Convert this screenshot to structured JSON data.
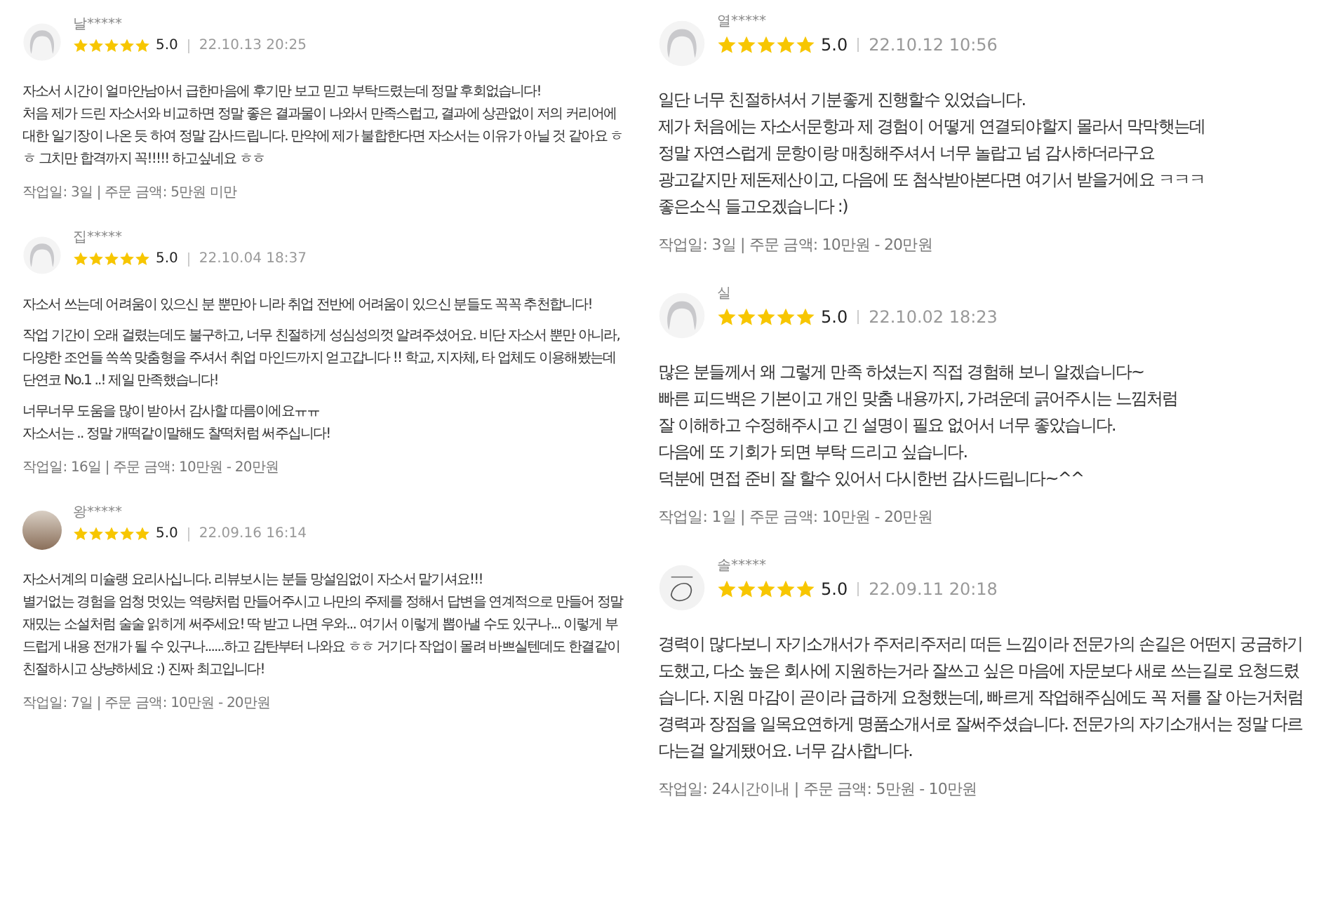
{
  "columns": [
    {
      "kind": "compact",
      "reviews": [
        {
          "avatar": {
            "kind": "default"
          },
          "name": "날*****",
          "stars": 5,
          "rating": "5.0",
          "date": "22.10.13 20:25",
          "paragraphs": [
            "자소서 시간이 얼마안남아서 급한마음에 후기만 보고 믿고 부탁드렸는데 정말 후회없습니다!\n처음 제가 드린 자소서와 비교하면 정말 좋은 결과물이 나와서 만족스럽고, 결과에 상관없이 저의 커리어에 대한 일기장이 나온 듯 하여 정말 감사드립니다. 만약에 제가 불합한다면 자소서는 이유가 아닐 것 같아요 ㅎㅎ 그치만 합격까지 꼭!!!!! 하고싶네요 ㅎㅎ"
          ],
          "meta": "작업일: 3일 | 주문 금액: 5만원 미만"
        },
        {
          "avatar": {
            "kind": "default"
          },
          "name": "집*****",
          "stars": 5,
          "rating": "5.0",
          "date": "22.10.04 18:37",
          "paragraphs": [
            "자소서 쓰는데 어려움이 있으신 분 뿐만아 니라 취업 전반에 어려움이 있으신 분들도 꼭꼭 추천합니다!",
            "작업 기간이 오래 걸렸는데도 불구하고, 너무 친절하게 성심성의껏 알려주셨어요. 비단 자소서 뿐만 아니라, 다양한 조언들 쏙쏙 맞춤형을 주셔서 취업 마인드까지 얻고갑니다 !! 학교, 지자체, 타 업체도 이용해봤는데 단연코 No.1 ..! 제일 만족했습니다!",
            "너무너무 도움을 많이 받아서 감사할 따름이에요ㅠㅠ\n자소서는 .. 정말 개떡같이말해도 찰떡처럼 써주십니다!"
          ],
          "meta": "작업일: 16일 | 주문 금액: 10만원 - 20만원"
        },
        {
          "avatar": {
            "kind": "photo"
          },
          "name": "왕*****",
          "stars": 5,
          "rating": "5.0",
          "date": "22.09.16 16:14",
          "paragraphs": [
            "자소서계의 미슐랭 요리사십니다. 리뷰보시는 분들 망설임없이 자소서 맡기셔요!!!\n별거없는 경험을 엄청 멋있는 역량처럼 만들어주시고 나만의 주제를 정해서 답변을 연계적으로 만들어 정말 재밌는 소설처럼 술술 읽히게 써주세요! 딱 받고 나면 우와... 여기서 이렇게 뽑아낼 수도  있구나... 이렇게 부드럽게 내용 전개가 될 수 있구나......하고 감탄부터 나와요 ㅎㅎ  거기다 작업이 몰려 바쁘실텐데도 한결같이 친절하시고 상냥하세요 :) 진짜 최고입니다!"
          ],
          "meta": "작업일: 7일 | 주문 금액: 10만원 - 20만원"
        }
      ]
    },
    {
      "kind": "wide",
      "reviews": [
        {
          "avatar": {
            "kind": "default"
          },
          "name": "열*****",
          "stars": 5,
          "rating": "5.0",
          "date": "22.10.12 10:56",
          "paragraphs": [
            "일단 너무 친절하셔서 기분좋게 진행할수 있었습니다.\n제가 처음에는 자소서문항과 제 경험이 어떻게 연결되야할지 몰라서 막막햇는데\n정말 자연스럽게 문항이랑 매칭해주셔서 너무 놀랍고 넘 감사하더라구요\n광고같지만 제돈제산이고, 다음에 또 첨삭받아본다면 여기서 받을거에요 ㅋㅋㅋ\n좋은소식 들고오겠습니다 :)"
          ],
          "meta": "작업일: 3일 | 주문 금액: 10만원 - 20만원"
        },
        {
          "avatar": {
            "kind": "default"
          },
          "name": "실",
          "stars": 5,
          "rating": "5.0",
          "date": "22.10.02 18:23",
          "paragraphs": [
            "많은 분들께서 왜 그렇게 만족 하셨는지 직접 경험해 보니 알겠습니다~\n빠른 피드백은 기본이고 개인 맞춤 내용까지, 가려운데 긁어주시는 느낌처럼\n잘 이해하고 수정해주시고 긴 설명이 필요 없어서 너무 좋았습니다.\n다음에 또 기회가 되면 부탁 드리고 싶습니다.\n덕분에 면접 준비 잘 할수 있어서 다시한번 감사드립니다~^^"
          ],
          "meta": "작업일: 1일 | 주문 금액: 10만원 - 20만원"
        },
        {
          "avatar": {
            "kind": "drawing"
          },
          "name": "솔*****",
          "stars": 5,
          "rating": "5.0",
          "date": "22.09.11 20:18",
          "paragraphs": [
            "경력이 많다보니 자기소개서가 주저리주저리 떠든 느낌이라 전문가의 손길은 어떤지 궁금하기도했고, 다소 높은 회사에 지원하는거라 잘쓰고 싶은 마음에 자문보다 새로 쓰는길로 요청드렸습니다. 지원 마감이 곧이라 급하게 요청했는데, 빠르게 작업해주심에도 꼭 저를 잘 아는거처럼 경력과 장점을 일목요연하게 명품소개서로 잘써주셨습니다. 전문가의 자기소개서는 정말 다르다는걸 알게됐어요. 너무 감사합니다."
          ],
          "meta": "작업일: 24시간이내 | 주문 금액: 5만원 - 10만원"
        }
      ]
    }
  ]
}
